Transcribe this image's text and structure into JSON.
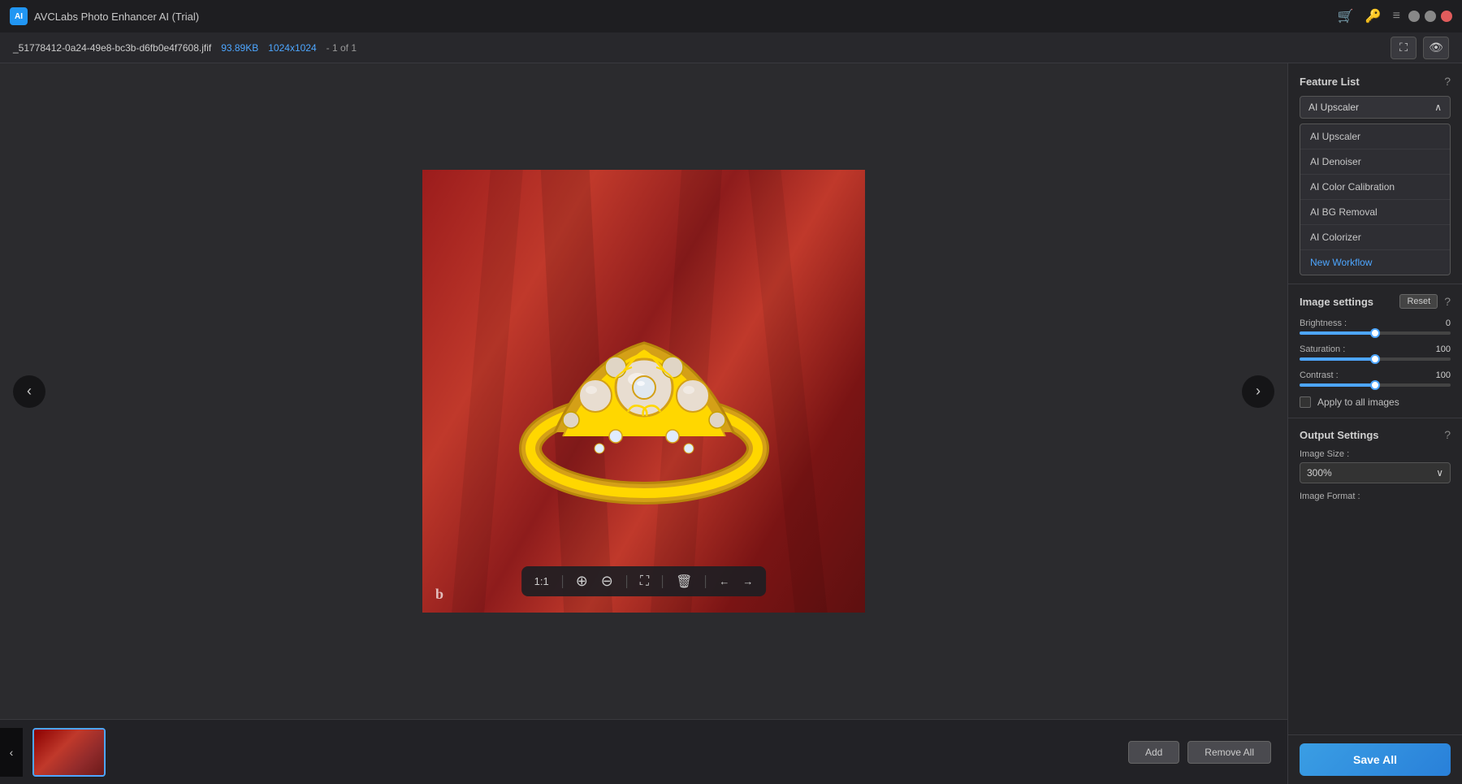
{
  "app": {
    "title": "AVCLabs Photo Enhancer AI (Trial)",
    "logo": "AI"
  },
  "titleBar": {
    "cart_icon": "🛒",
    "key_icon": "🔑",
    "menu_icon": "≡",
    "minimize": "—",
    "maximize": "□",
    "close": "✕"
  },
  "fileInfo": {
    "filename": "_51778412-0a24-49e8-bc3b-d6fb0e4f7608.jfif",
    "filesize": "93.89KB",
    "dimensions": "1024x1024",
    "count": "- 1 of 1"
  },
  "viewer": {
    "zoom_100": "1:1",
    "zoom_in": "+",
    "zoom_out": "−",
    "crop": "⛶",
    "delete": "🗑",
    "prev": "←",
    "next": "→"
  },
  "bottomBar": {
    "add_label": "Add",
    "remove_all_label": "Remove All"
  },
  "featureList": {
    "title": "Feature List",
    "selected": "AI Upscaler",
    "items": [
      {
        "label": "AI Upscaler"
      },
      {
        "label": "AI Denoiser"
      },
      {
        "label": "AI Color Calibration"
      },
      {
        "label": "AI BG Removal"
      },
      {
        "label": "AI Colorizer"
      },
      {
        "label": "New Workflow",
        "type": "new"
      }
    ]
  },
  "imageSettings": {
    "title": "Image settings",
    "reset_label": "Reset",
    "brightness_label": "Brightness :",
    "brightness_value": "0",
    "brightness_pct": 50,
    "saturation_label": "Saturation :",
    "saturation_value": "100",
    "saturation_pct": 50,
    "contrast_label": "Contrast :",
    "contrast_value": "100",
    "contrast_pct": 50,
    "apply_all_label": "Apply to all images"
  },
  "outputSettings": {
    "title": "Output Settings",
    "size_label": "Image Size :",
    "size_value": "300%",
    "format_label": "Image Format :",
    "save_label": "Save All"
  }
}
